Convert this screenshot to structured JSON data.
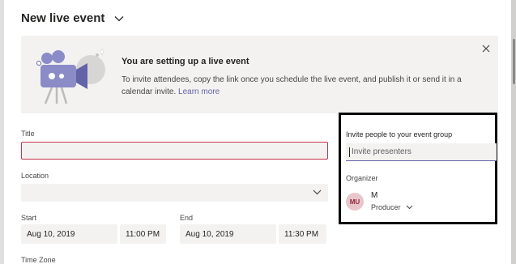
{
  "header": {
    "title": "New live event"
  },
  "banner": {
    "heading": "You are setting up a live event",
    "body": "To invite attendees, copy the link once you schedule the live event, and publish it or send it in a calendar invite.",
    "link_label": "Learn more"
  },
  "form": {
    "title_label": "Title",
    "title_value": "",
    "location_label": "Location",
    "location_value": "",
    "start_label": "Start",
    "start_date": "Aug 10, 2019",
    "start_time": "11:00 PM",
    "end_label": "End",
    "end_date": "Aug 10, 2019",
    "end_time": "11:30 PM",
    "timezone_label": "Time Zone"
  },
  "invite": {
    "label": "Invite people to your event group",
    "placeholder": "Invite presenters",
    "organizer_label": "Organizer",
    "organizer_initials": "MU",
    "organizer_name": "M",
    "organizer_role": "Producer"
  },
  "colors": {
    "accent": "#6264a7",
    "error": "#c4314b",
    "avatar_bg": "#e8c6cb"
  }
}
